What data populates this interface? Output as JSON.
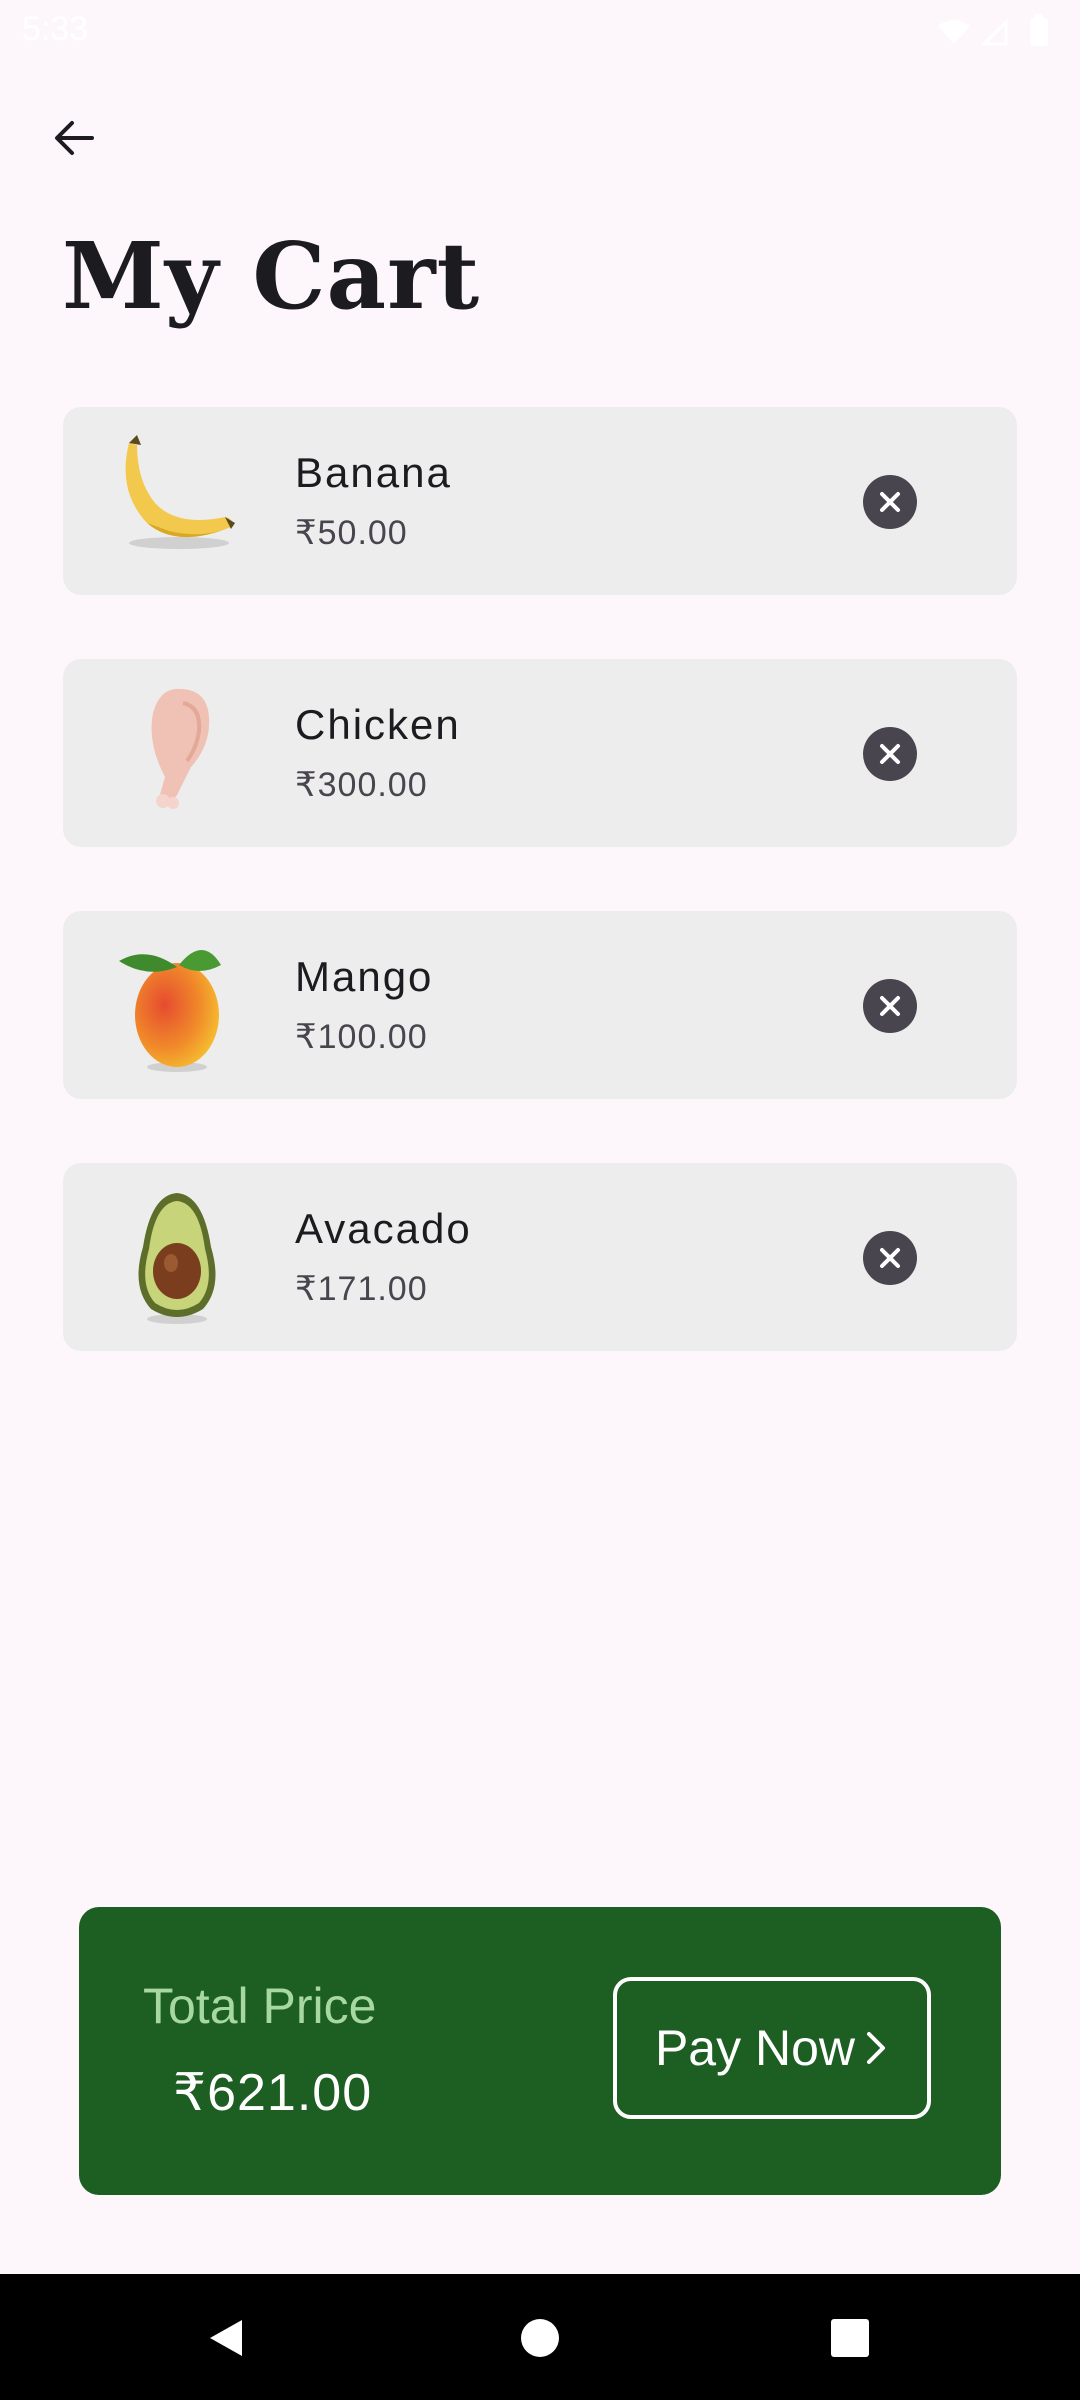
{
  "status_bar": {
    "time": "5:33"
  },
  "header": {
    "back_icon": "arrow-left-icon",
    "title": "My Cart"
  },
  "cart": {
    "items": [
      {
        "name": "Banana",
        "price": "₹50.00",
        "image": "banana",
        "remove_icon": "close-circle-icon"
      },
      {
        "name": "Chicken",
        "price": "₹300.00",
        "image": "chicken-drumstick",
        "remove_icon": "close-circle-icon"
      },
      {
        "name": "Mango",
        "price": "₹100.00",
        "image": "mango",
        "remove_icon": "close-circle-icon"
      },
      {
        "name": "Avacado",
        "price": "₹171.00",
        "image": "avocado",
        "remove_icon": "close-circle-icon"
      }
    ]
  },
  "checkout": {
    "total_label": "Total Price",
    "total_value": "₹621.00",
    "pay_label": "Pay Now",
    "pay_icon": "chevron-right-icon"
  },
  "colors": {
    "background": "#fdf7fc",
    "card": "#eeedee",
    "checkout_bg": "#1d5e22",
    "total_label": "#a7d8a3",
    "remove_icon": "#49454f"
  },
  "nav_bar": {
    "back_icon": "triangle-back-icon",
    "home_icon": "circle-home-icon",
    "recents_icon": "square-recents-icon"
  }
}
